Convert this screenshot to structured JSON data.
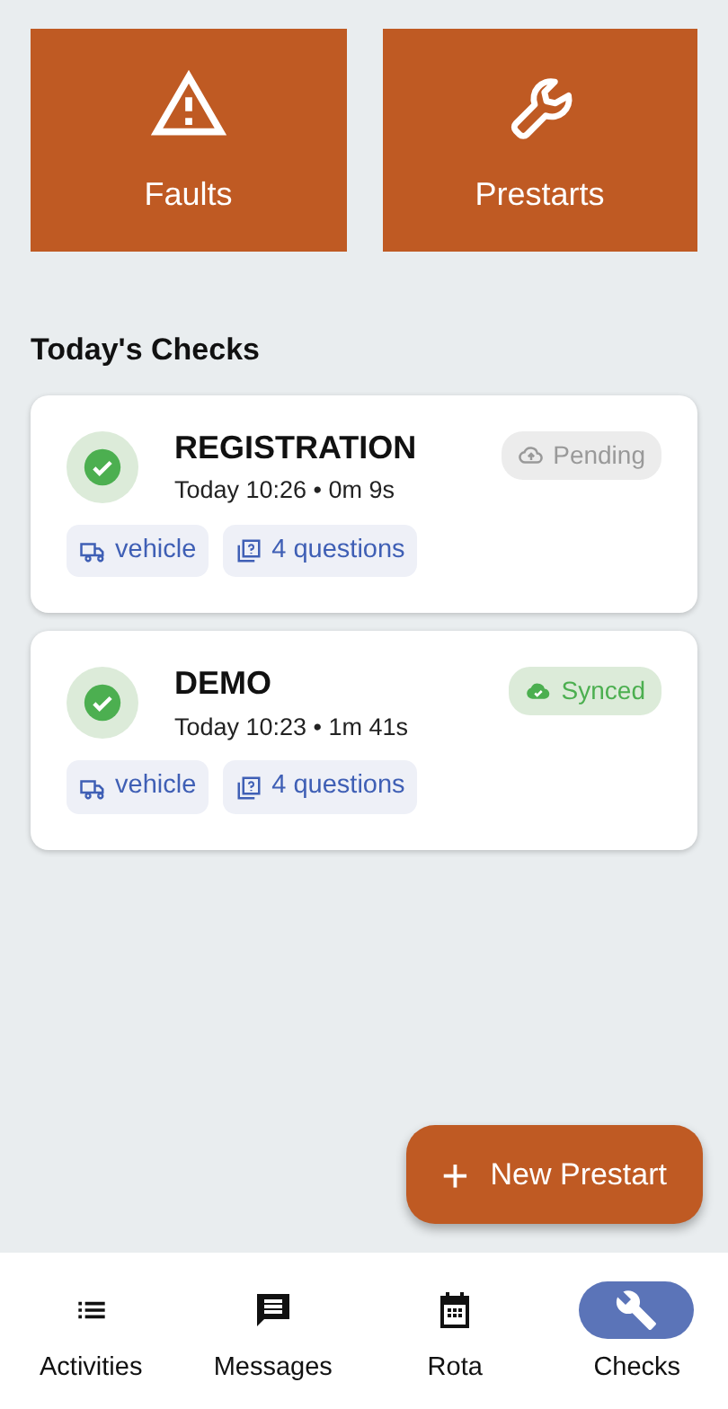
{
  "tiles": [
    {
      "kind": "faults",
      "label": "Faults"
    },
    {
      "kind": "prestarts",
      "label": "Prestarts"
    }
  ],
  "section_title": "Today's Checks",
  "checks": [
    {
      "title": "REGISTRATION",
      "subtitle": "Today 10:26 • 0m 9s",
      "completed": true,
      "status": {
        "kind": "pending",
        "label": "Pending"
      },
      "tags": [
        {
          "kind": "vehicle",
          "label": "vehicle"
        },
        {
          "kind": "questions",
          "label": "4 questions"
        }
      ]
    },
    {
      "title": "DEMO",
      "subtitle": "Today 10:23 • 1m 41s",
      "completed": true,
      "status": {
        "kind": "synced",
        "label": "Synced"
      },
      "tags": [
        {
          "kind": "vehicle",
          "label": "vehicle"
        },
        {
          "kind": "questions",
          "label": "4 questions"
        }
      ]
    }
  ],
  "fab": {
    "icon": "+",
    "label": "New Prestart"
  },
  "nav": [
    {
      "kind": "activities",
      "label": "Activities",
      "selected": false
    },
    {
      "kind": "messages",
      "label": "Messages",
      "selected": false
    },
    {
      "kind": "rota",
      "label": "Rota",
      "selected": false
    },
    {
      "kind": "checks",
      "label": "Checks",
      "selected": true
    }
  ]
}
